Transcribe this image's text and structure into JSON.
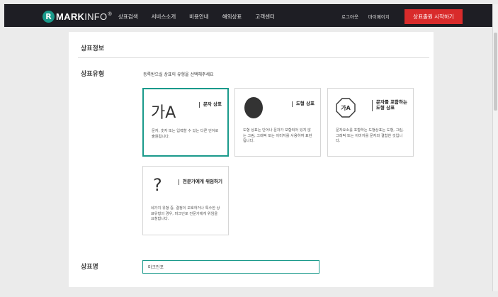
{
  "header": {
    "logo_initial": "R",
    "logo_bold": "MARK",
    "logo_light": "INFO",
    "logo_mark": "®",
    "nav": [
      "상표검색",
      "서비스소개",
      "비용안내",
      "해외상표",
      "고객센터"
    ],
    "user_links": [
      "로그아웃",
      "마이페이지"
    ],
    "cta_label": "상표출원 시작하기"
  },
  "section_title": "상표정보",
  "type_label": "상표유형",
  "instruction": "등록받으실 상표의 유형을 선택해주세요",
  "cards": [
    {
      "icon_text": "가A",
      "title": "문자 상표",
      "desc": "문자, 숫자 또는 입력할 수 있는 다른 언어로 출원됩니다.",
      "selected": true
    },
    {
      "title": "도형 상표",
      "desc": "도형 상표는 단어나 문자가 포함되어 있지 않는 그림, 그래픽 또는 이미지를 사용하여 표현됩니다."
    },
    {
      "icon_text": "가A",
      "title_line1": "문자를 포함하는",
      "title_line2": "도형 상표",
      "desc": "문자요소를 포함하는 도형상표는 도형, 그림, 그래픽 또는 이미지를 문자와 결합한 것입니다."
    },
    {
      "icon_text": "?",
      "title": "전문가에게 위임하기",
      "desc": "네가지 유형 중, 결정이 모호하거나 특수한 상표유형의 경우, 마크인포 전문가에게 위임을 요청합니다."
    }
  ],
  "name_label": "상표명",
  "name_input": {
    "value": "마크인포"
  },
  "colors": {
    "accent": "#1a9a8b",
    "cta": "#d92b2b",
    "topbar": "#1e1e24"
  }
}
